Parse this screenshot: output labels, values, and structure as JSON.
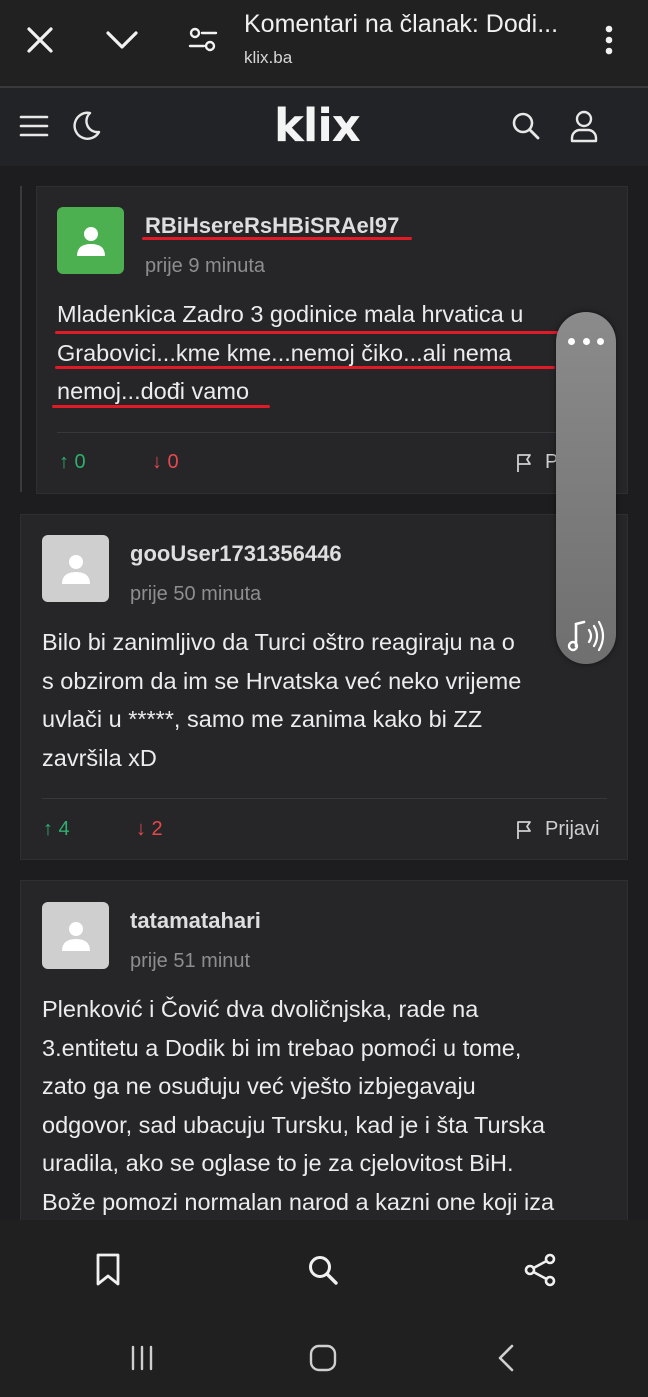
{
  "browser": {
    "title": "Komentari na članak: Dodi...",
    "url": "klix.ba"
  },
  "site": {
    "logo": "klix"
  },
  "comments": [
    {
      "username": "RBiHsereRsHBiSRAel97",
      "time": "prije 9 minuta",
      "text_lines": [
        "Mladenkica Zadro 3 godinice mala hrvatica u",
        "Grabovici...kme kme...nemoj čiko...ali nema",
        "nemoj...dođi vamo"
      ],
      "upvotes": "↑ 0",
      "downvotes": "↓ 0",
      "report_label": "P"
    },
    {
      "username": "gooUser1731356446",
      "time": "prije 50 minuta",
      "text_lines": [
        "Bilo bi zanimljivo da Turci oštro reagiraju na o",
        "s obzirom da im se Hrvatska već neko vrijeme",
        "uvlači u *****, samo me zanima kako bi ZZ",
        "završila xD"
      ],
      "upvotes": "↑ 4",
      "downvotes": "↓ 2",
      "report_label": "Prijavi"
    },
    {
      "username": "tatamatahari",
      "time": "prije 51 minut",
      "text_lines": [
        "Plenković i Čović dva dvoličnjska, rade na",
        "3.entitetu a Dodik bi im trebao pomoći u tome,",
        "zato ga ne osuđuju već vješto izbjegavaju",
        "odgovor, sad ubacuju Tursku, kad je i šta Turska",
        "uradila, ako se oglase to je za cjelovitost BiH.",
        "Bože pomozi normalan narod a kazni one koji iza"
      ]
    }
  ],
  "icons": {
    "close": "close-icon",
    "chevron": "chevron-down-icon",
    "settings": "tune-icon",
    "more": "more-vert-icon",
    "menu": "menu-icon",
    "theme": "moon-icon",
    "search": "search-icon",
    "account": "user-icon",
    "bookmark": "bookmark-icon",
    "share": "share-icon",
    "audio": "music-note-icon"
  },
  "colors": {
    "upvote": "#2fae6e",
    "downvote": "#e5484d",
    "annotation": "#e11a28",
    "avatar_green": "#4caf50"
  }
}
